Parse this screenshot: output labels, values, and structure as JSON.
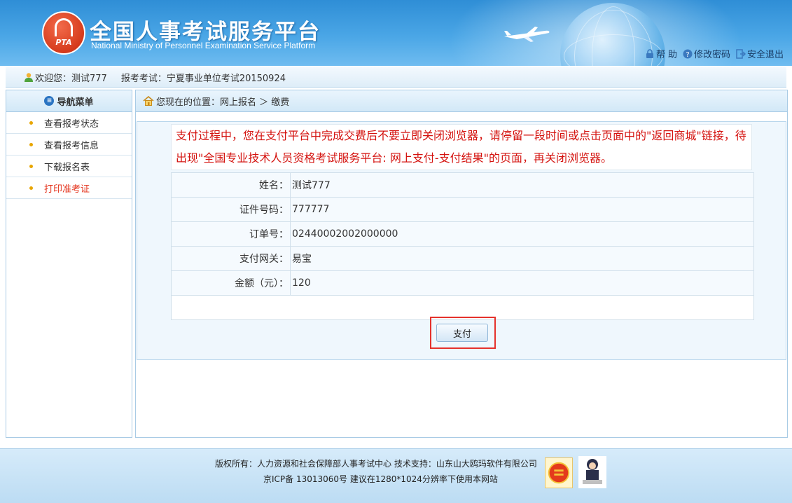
{
  "header": {
    "title": "全国人事考试服务平台",
    "subtitle": "National Ministry of Personnel Examination Service Platform",
    "logo_text": "PTA",
    "links": [
      {
        "label": "帮 助",
        "icon": "lock-icon"
      },
      {
        "label": "修改密码",
        "icon": "help-circle-icon"
      },
      {
        "label": "安全退出",
        "icon": "exit-icon"
      }
    ]
  },
  "welcome": {
    "text": "欢迎您：测试777",
    "exam": "报考考试：宁夏事业单位考试20150924"
  },
  "nav": {
    "title": "导航菜单",
    "items": [
      {
        "label": "查看报考状态"
      },
      {
        "label": "查看报考信息"
      },
      {
        "label": "下载报名表"
      },
      {
        "label": "打印准考证"
      }
    ]
  },
  "breadcrumb": {
    "text": "您现在的位置：网上报名 ＞ 缴费"
  },
  "notice": "支付过程中，您在支付平台中完成交费后不要立即关闭浏览器，请停留一段时间或点击页面中的\"返回商城\"链接，待出现\"全国专业技术人员资格考试服务平台: 网上支付-支付结果\"的页面，再关闭浏览器。",
  "payment": {
    "rows": [
      {
        "key": "姓名：",
        "value": "测试777"
      },
      {
        "key": "证件号码：",
        "value": "777777"
      },
      {
        "key": "订单号：",
        "value": "02440002002000000"
      },
      {
        "key": "支付网关：",
        "value": "易宝"
      },
      {
        "key": "金额（元）：",
        "value": "120"
      }
    ],
    "pay_label": "支付"
  },
  "footer": {
    "line1": "版权所有：人力资源和社会保障部人事考试中心  技术支持：山东山大鸥玛软件有限公司",
    "line2": "京ICP备 13013060号  建议在1280*1024分辨率下使用本网站"
  },
  "colors": {
    "header_blue": "#2f8ed6",
    "notice_red": "#d4120e",
    "active_nav": "#e4321b",
    "highlight_border": "#e5322c"
  }
}
